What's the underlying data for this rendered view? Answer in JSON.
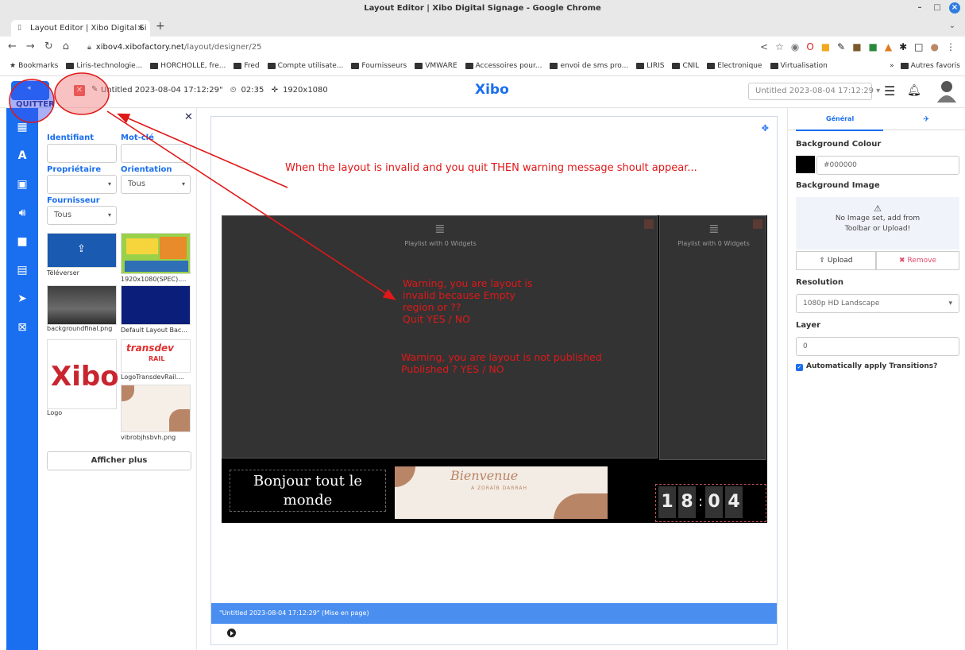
{
  "window": {
    "title": "Layout Editor | Xibo Digital Signage - Google Chrome"
  },
  "tab": {
    "label": "Layout Editor | Xibo Digital Si"
  },
  "address": {
    "host": "xibov4.xibofactory.net",
    "path": "/layout/designer/25"
  },
  "bookmarks": {
    "items": [
      "Bookmarks",
      "Liris-technologie...",
      "HORCHOLLE, fre...",
      "Fred",
      "Compte utilisate...",
      "Fournisseurs",
      "VMWARE",
      "Accessoires pour...",
      "envoi de sms pro...",
      "LIRIS",
      "CNIL",
      "Electronique",
      "Virtualisation"
    ],
    "more": "»",
    "others": "Autres favoris"
  },
  "header": {
    "quit_label": "QUITTER",
    "layout_name": "Untitled 2023-08-04 17:12:29\"",
    "duration": "02:35",
    "resolution": "1920x1080",
    "logo": "Xibo",
    "layout_select": "Untitled 2023-08-04 17:12:29"
  },
  "library": {
    "identifiant_label": "Identifiant",
    "motcle_label": "Mot-clé",
    "proprietaire_label": "Propriétaire",
    "orientation_label": "Orientation",
    "orientation_value": "Tous",
    "fournisseur_label": "Fournisseur",
    "fournisseur_value": "Tous",
    "items": [
      {
        "caption": "Téléverser"
      },
      {
        "caption": "1920x1080(SPEC)...."
      },
      {
        "caption": "backgroundfinal.png"
      },
      {
        "caption": "Default Layout Bac..."
      },
      {
        "caption": "Logo"
      },
      {
        "caption": "LogoTransdevRail...."
      },
      {
        "caption": "vibrobjhsbvh.png"
      }
    ],
    "show_more": "Afficher plus",
    "xibo_thumb_text": "Xibo",
    "transdev_text": "transdev",
    "transdev_sub": "RAIL"
  },
  "canvas": {
    "region1_text": "Playlist with 0 Widgets",
    "region2_text": "Playlist with 0 Widgets",
    "text_widget": "Bonjour tout le monde",
    "image_widget_title": "Bienvenue",
    "image_widget_sub": "A ZORAÏB DARRAH",
    "clock_digits": [
      "1",
      "8",
      "0",
      "4"
    ],
    "status_bar": "\"Untitled 2023-08-04 17:12:29\" (Mise en page)"
  },
  "properties": {
    "tab_general": "Général",
    "background_colour_label": "Background Colour",
    "background_colour_value": "#000000",
    "background_image_label": "Background Image",
    "no_image_text": "No Image set, add from Toolbar or Upload!",
    "upload_label": "Upload",
    "remove_label": "Remove",
    "resolution_label": "Resolution",
    "resolution_value": "1080p HD Landscape",
    "layer_label": "Layer",
    "layer_value": "0",
    "auto_transitions_label": "Automatically apply Transitions?"
  },
  "annotations": {
    "arrow_text": "When the layout is invalid and you quit THEN warning message shoult appear...",
    "warning1": [
      "Warning, you are layout is",
      "invalid because Empty",
      "region or ??",
      "Quit YES / NO"
    ],
    "warning2": [
      "Warning, you are layout is not published",
      "Published ? YES / NO"
    ]
  },
  "colors": {
    "accent": "#1a6ef0",
    "annotation": "#e01818",
    "stage": "#000000"
  }
}
